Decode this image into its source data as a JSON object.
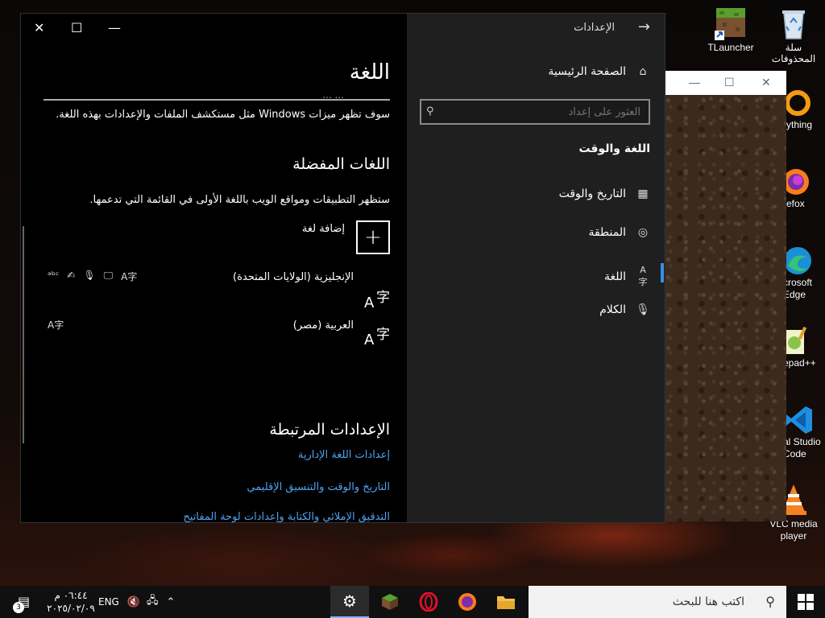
{
  "settings_window": {
    "app_title": "الإعدادات",
    "nav": {
      "home": "الصفحة الرئيسية",
      "search_placeholder": "العثور على إعداد",
      "section_heading": "اللغة والوقت",
      "items": [
        {
          "label": "التاريخ والوقت",
          "icon": "calendar-clock-icon"
        },
        {
          "label": "المنطقة",
          "icon": "globe-icon"
        },
        {
          "label": "اللغة",
          "icon": "language-icon"
        },
        {
          "label": "الكلام",
          "icon": "microphone-icon"
        }
      ]
    },
    "content": {
      "page_title": "اللغة",
      "cut_text": "... ...",
      "description": "سوف تظهر ميزات Windows مثل مستكشف الملفات والإعدادات بهذه اللغة.",
      "preferred_heading": "اللغات المفضلة",
      "preferred_description": "ستظهر التطبيقات ومواقع الويب باللغة الأولى في القائمة التي تدعمها.",
      "add_language": "إضافة لغة",
      "add_glyph": "+",
      "lang_glyph_a": "A",
      "lang_glyph_z": "字",
      "languages": [
        {
          "name": "الإنجليزية (الولايات المتحدة)",
          "features": [
            "display-language-icon",
            "speech-icon",
            "handwriting-icon",
            "spelling-icon",
            "abc-icon"
          ]
        },
        {
          "name": "العربية (مصر)",
          "features": [
            "display-language-icon"
          ]
        }
      ],
      "related_heading": "الإعدادات المرتبطة",
      "links": [
        "إعدادات اللغة الإدارية",
        "التاريخ والوقت والتنسيق الإقليمي",
        "التدقيق الإملائي والكتابة وإعدادات لوحة المفاتيح"
      ]
    }
  },
  "desktop_icons": [
    {
      "label": "TLauncher"
    },
    {
      "label": "سلة المحذوفات"
    },
    {
      "label": "rything"
    },
    {
      "label": "refox"
    },
    {
      "label": "crosoft Edge"
    },
    {
      "label": "epad++"
    },
    {
      "label": "al Studio Code"
    },
    {
      "label": "VLC media player"
    }
  ],
  "taskbar": {
    "search_text": "اكتب هنا للبحث",
    "time": "٠٦:٤٤ م",
    "date": "٢٠٢٥/٠٢/٠٩",
    "language": "ENG",
    "notification_count": "3",
    "accent": "#8ab4f8"
  },
  "link_color": "#4fa3f0"
}
